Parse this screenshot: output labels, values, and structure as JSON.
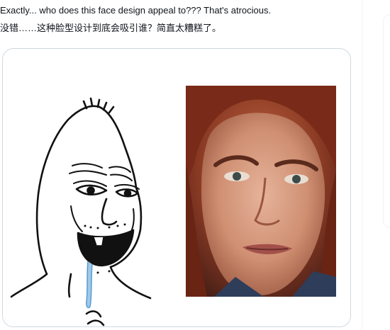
{
  "post": {
    "text_en": "Exactly... who does this face design appeal to??? That's atrocious.",
    "text_zh": "没错……这种脸型设计到底会吸引谁？简直太糟糕了。"
  },
  "media": {
    "left_image_icon": "wojak-meme-drawing",
    "right_image_icon": "red-haired-woman-face-photo"
  },
  "colors": {
    "text": "#0f1419",
    "border": "#cfd9de",
    "background": "#ffffff"
  }
}
